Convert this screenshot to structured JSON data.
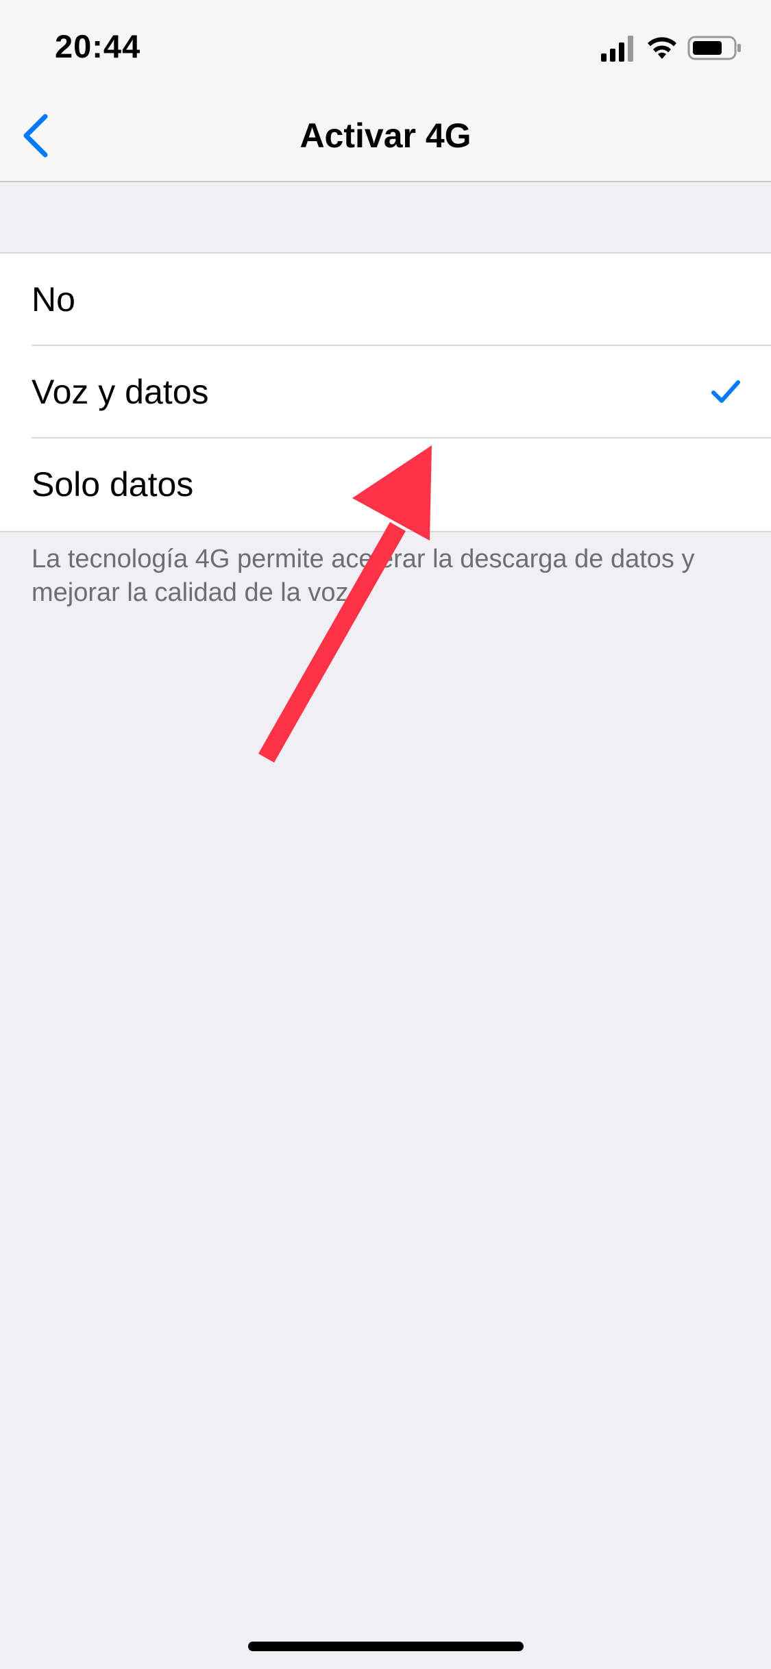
{
  "status_bar": {
    "time": "20:44",
    "icons": [
      "signal-icon",
      "wifi-icon",
      "battery-icon"
    ]
  },
  "nav": {
    "title": "Activar 4G",
    "back_icon": "chevron-left-icon"
  },
  "options": {
    "items": [
      {
        "label": "No",
        "selected": false
      },
      {
        "label": "Voz y datos",
        "selected": true
      },
      {
        "label": "Solo datos",
        "selected": false
      }
    ]
  },
  "footer": {
    "note": "La tecnología 4G permite acelerar la descarga de datos y mejorar la calidad de la voz."
  },
  "colors": {
    "accent": "#007AFF",
    "background": "#EFEFF4",
    "annotation": "#FF3347"
  }
}
